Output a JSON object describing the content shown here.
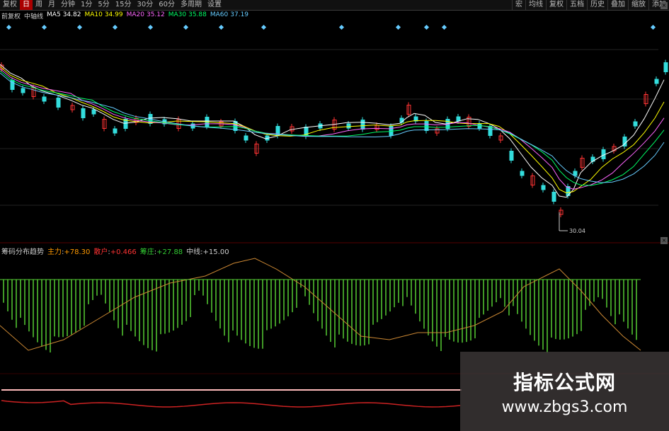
{
  "toolbar": {
    "left": [
      "复权",
      "日",
      "周",
      "月",
      "分钟",
      "1分",
      "5分",
      "15分",
      "30分",
      "60分",
      "多周期",
      "设置"
    ],
    "right": [
      "宏",
      "均线",
      "复权",
      "五档",
      "历史",
      "叠加",
      "缩放",
      "添加"
    ],
    "active_index": 1
  },
  "ma_legend": {
    "prefix": "前复权",
    "label1": "中轴线",
    "items": [
      {
        "name": "MA5",
        "value": "34.82",
        "color": "#ffffff"
      },
      {
        "name": "MA10",
        "value": "34.99",
        "color": "#ffff00"
      },
      {
        "name": "MA20",
        "value": "35.12",
        "color": "#ff66ff"
      },
      {
        "name": "MA30",
        "value": "35.88",
        "color": "#00ff66"
      },
      {
        "name": "MA60",
        "value": "37.19",
        "color": "#66ccff"
      }
    ]
  },
  "low_price_label": "30.04",
  "indicator_legend": {
    "name": "筹码分布趋势",
    "items": [
      {
        "name": "主力",
        "value": "+78.30",
        "color": "#ff9900"
      },
      {
        "name": "散户",
        "value": "+0.466",
        "color": "#ff3333"
      },
      {
        "name": "筹庄",
        "value": "+27.88",
        "color": "#33cc33"
      },
      {
        "name": "中线",
        "value": "+15.00",
        "color": "#cccccc"
      }
    ]
  },
  "watermark": {
    "title": "指标公式网",
    "url": "www.zbgs3.com"
  },
  "colors": {
    "up": "#ff3333",
    "down": "#33dddd",
    "bar": "#55cc33",
    "line_orange": "#cc8833",
    "line_red": "#cc2222",
    "grid": "#222222"
  }
}
